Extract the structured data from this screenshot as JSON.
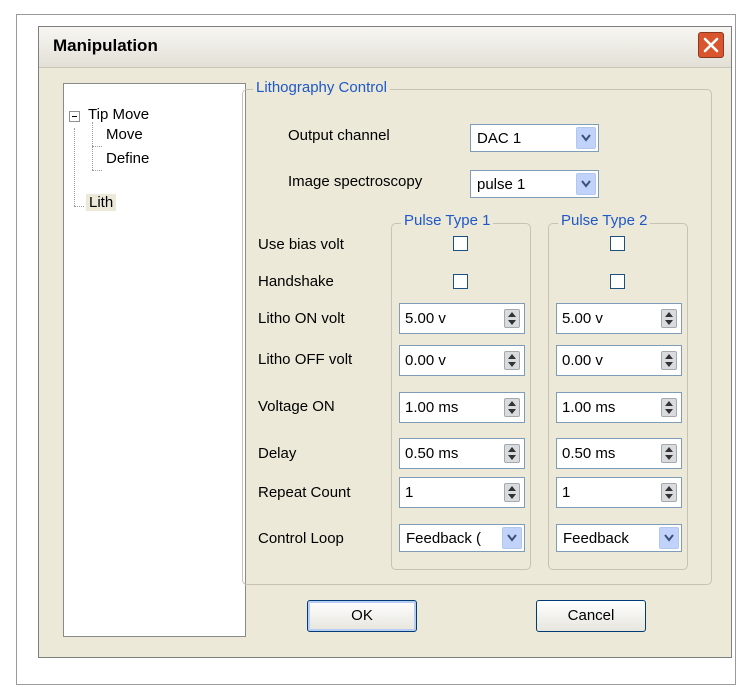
{
  "dialog": {
    "title": "Manipulation"
  },
  "tree": {
    "items": [
      {
        "label": "Tip Move"
      },
      {
        "label": "Move"
      },
      {
        "label": "Define"
      },
      {
        "label": "Lith"
      }
    ]
  },
  "lithography": {
    "group_title": "Lithography Control",
    "output_channel_label": "Output channel",
    "output_channel_value": "DAC 1",
    "image_spectroscopy_label": "Image spectroscopy",
    "image_spectroscopy_value": "pulse 1"
  },
  "pulse_types": {
    "type1_title": "Pulse Type 1",
    "type2_title": "Pulse Type 2"
  },
  "rows": {
    "use_bias_volt": "Use bias volt",
    "handshake": "Handshake",
    "litho_on_volt": "Litho ON volt",
    "litho_off_volt": "Litho OFF volt",
    "voltage_on": "Voltage ON",
    "delay": "Delay",
    "repeat_count": "Repeat Count",
    "control_loop": "Control Loop"
  },
  "pulse1": {
    "use_bias_volt": false,
    "handshake": false,
    "litho_on_volt": "5.00 v",
    "litho_off_volt": "0.00 v",
    "voltage_on": "1.00 ms",
    "delay": "0.50 ms",
    "repeat_count": "1",
    "control_loop": "Feedback ("
  },
  "pulse2": {
    "use_bias_volt": false,
    "handshake": false,
    "litho_on_volt": "5.00 v",
    "litho_off_volt": "0.00 v",
    "voltage_on": "1.00 ms",
    "delay": "0.50 ms",
    "repeat_count": "1",
    "control_loop": "Feedback"
  },
  "buttons": {
    "ok": "OK",
    "cancel": "Cancel"
  },
  "colors": {
    "accent": "#1f58c8",
    "close": "#d9552d",
    "dialog_bg": "#ece9d8"
  }
}
